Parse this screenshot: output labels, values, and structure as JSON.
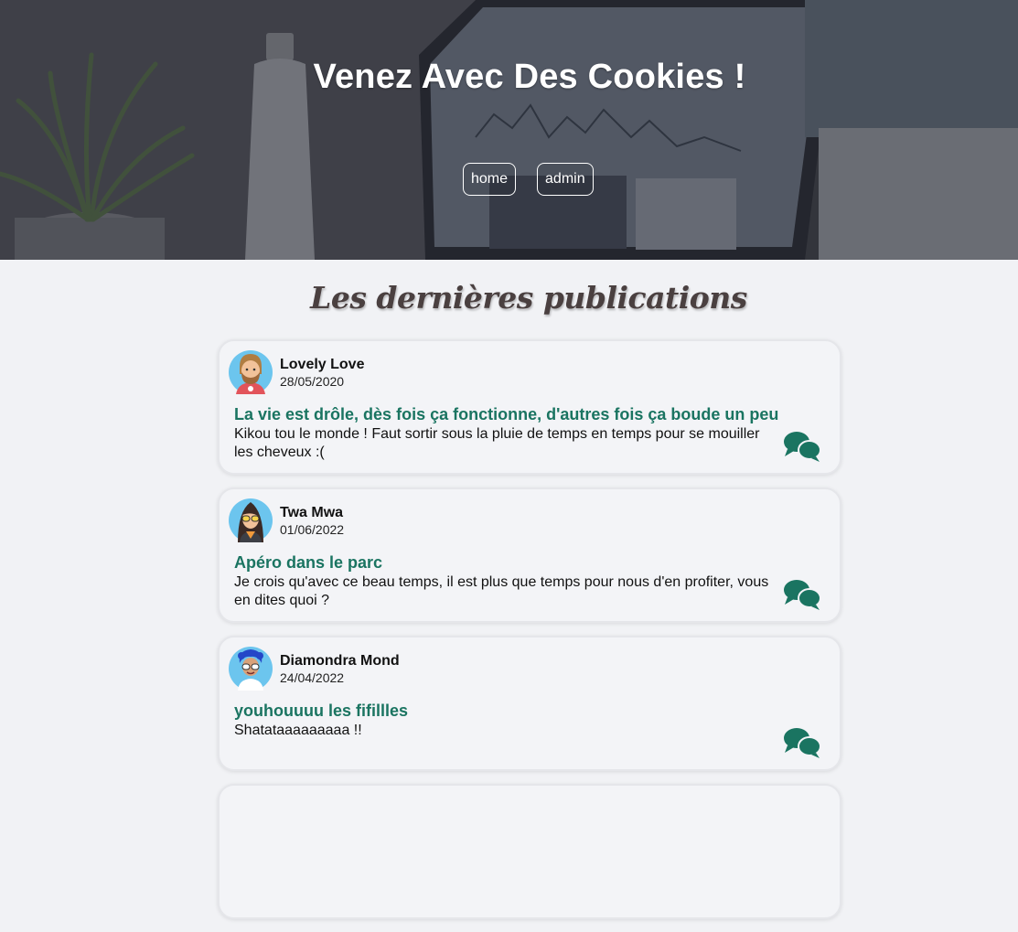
{
  "header": {
    "title": "Venez Avec Des Cookies !",
    "nav": [
      {
        "label": "home"
      },
      {
        "label": "admin"
      }
    ]
  },
  "main": {
    "section_title": "Les dernières publications",
    "posts": [
      {
        "author": "Lovely Love",
        "date": "28/05/2020",
        "title": "La vie est drôle, dès fois ça fonctionne, d'autres fois ça boude un peu",
        "body": "Kikou tou le monde ! Faut sortir sous la pluie de temps en temps pour se mouiller les cheveux :(",
        "avatar_icon": "bearded-man-avatar-icon"
      },
      {
        "author": "Twa Mwa",
        "date": "01/06/2022",
        "title": "Apéro dans le parc",
        "body": "Je crois qu'avec ce beau temps, il est plus que temps pour nous d'en profiter, vous en dites quoi ?",
        "avatar_icon": "woman-sunglasses-avatar-icon"
      },
      {
        "author": "Diamondra Mond",
        "date": "24/04/2022",
        "title": "youhouuuu les fifillles",
        "body": "Shatataaaaaaaaa !!",
        "avatar_icon": "blue-hair-avatar-icon"
      }
    ]
  },
  "colors": {
    "accent": "#1a7461",
    "page_bg": "#f1f2f5",
    "card_border": "#e5e6ea",
    "avatar_bg": "#6cc5ee"
  },
  "icons": {
    "comment": "comments-icon"
  }
}
